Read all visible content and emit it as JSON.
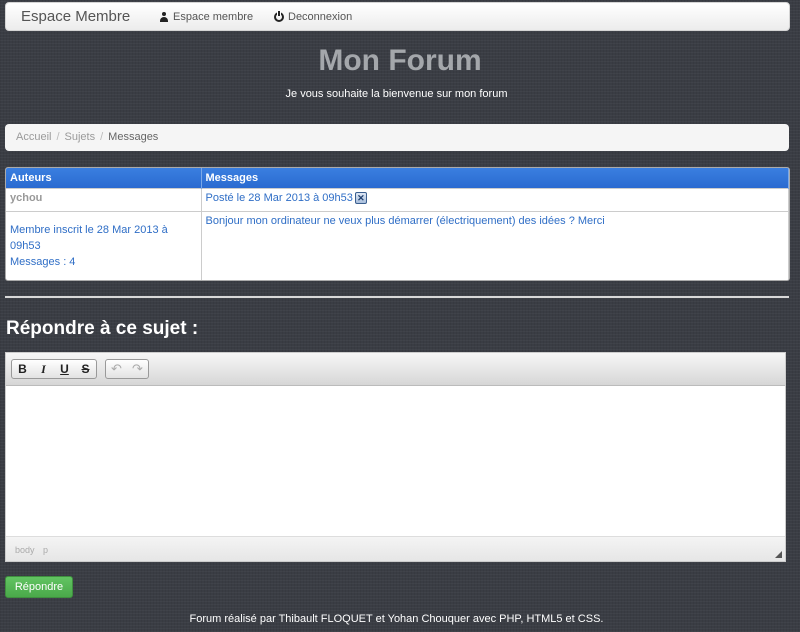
{
  "navbar": {
    "brand": "Espace Membre",
    "links": [
      {
        "label": "Espace membre",
        "icon": "user-icon"
      },
      {
        "label": "Deconnexion",
        "icon": "power-icon"
      }
    ]
  },
  "header": {
    "title": "Mon Forum",
    "subtitle": "Je vous souhaite la bienvenue sur mon forum"
  },
  "breadcrumb": {
    "items": [
      "Accueil",
      "Sujets"
    ],
    "separator": "/",
    "active": "Messages"
  },
  "posts_table": {
    "columns": [
      "Auteurs",
      "Messages"
    ],
    "rows": [
      {
        "author": "ychou",
        "posted": "Posté le 28 Mar 2013 à 09h53",
        "author_info": [
          "Membre inscrit le 28 Mar 2013 à 09h53",
          "Messages : 4"
        ],
        "message": "Bonjour mon ordinateur ne veux plus démarrer (électriquement) des idées ? Merci"
      }
    ]
  },
  "reply": {
    "title": "Répondre à ce sujet :",
    "toolbar": {
      "bold": "B",
      "italic": "I",
      "underline": "U",
      "strike": "S",
      "undo": "↶",
      "redo": "↷"
    },
    "statusbar_path": [
      "body",
      "p"
    ],
    "submit_label": "Répondre"
  },
  "colors": {
    "header_blue": "#2f6ec6",
    "reply_green": "#5bb75b"
  },
  "footer": {
    "text": "Forum réalisé par Thibault FLOQUET et Yohan Chouquer avec PHP, HTML5 et CSS."
  }
}
